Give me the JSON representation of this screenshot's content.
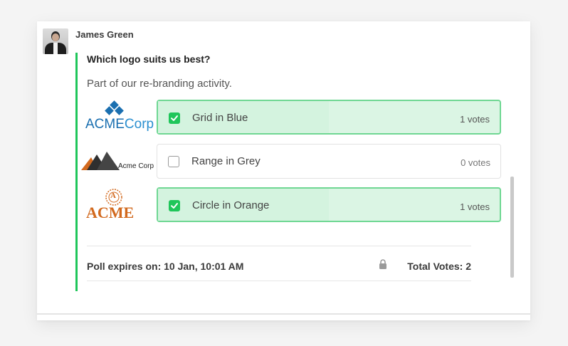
{
  "author": {
    "name": "James Green"
  },
  "poll": {
    "question": "Which logo suits us best?",
    "description": "Part of our re-branding activity.",
    "options": [
      {
        "label": "Grid in Blue",
        "votes": "1 votes",
        "selected": true,
        "logo_text_a": "ACME",
        "logo_text_b": "Corp"
      },
      {
        "label": "Range in Grey",
        "votes": "0 votes",
        "selected": false,
        "logo_text": "Acme Corp"
      },
      {
        "label": "Circle in Orange",
        "votes": "1 votes",
        "selected": true,
        "logo_text": "ACME",
        "logo_mark": "A"
      }
    ],
    "expiry": "Poll expires on: 10 Jan, 10:01 AM",
    "total_votes": "Total Votes: 2"
  },
  "colors": {
    "accent_green": "#1fc65a",
    "selected_bg": "#dbf5e4",
    "selected_border": "#6fd793",
    "logo_blue": "#1a6fb0",
    "logo_orange": "#d2691e"
  },
  "icons": {
    "checked": "check-icon",
    "lock": "lock-icon",
    "avatar": "user-photo"
  }
}
